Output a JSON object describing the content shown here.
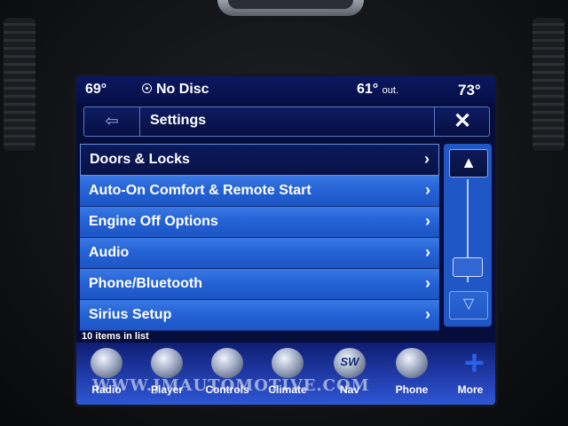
{
  "status": {
    "left_temp": "69°",
    "disc": "No Disc",
    "outside_temp": "61°",
    "outside_label": "out.",
    "right_temp": "73°"
  },
  "header": {
    "back_icon": "⇦",
    "title": "Settings",
    "close_icon": "✕"
  },
  "menu": {
    "items": [
      {
        "label": "Doors & Locks",
        "selected": true
      },
      {
        "label": "Auto-On Comfort & Remote Start"
      },
      {
        "label": "Engine Off Options"
      },
      {
        "label": "Audio"
      },
      {
        "label": "Phone/Bluetooth"
      },
      {
        "label": "Sirius Setup"
      }
    ],
    "chevron": "›",
    "count_text": "10 items in list"
  },
  "scroll": {
    "up_icon": "▲",
    "down_icon": "▽"
  },
  "dock": {
    "items": [
      "Radio",
      "Player",
      "Controls",
      "Climate",
      "Nav",
      "Phone",
      "More"
    ],
    "nav_badge": "SW"
  },
  "watermark": "WWW.JMAUTOMOTIVE.COM",
  "colors": {
    "screen_bg": "#050d3a",
    "row_blue": "#2563d6",
    "accent": "#5d76c7"
  }
}
